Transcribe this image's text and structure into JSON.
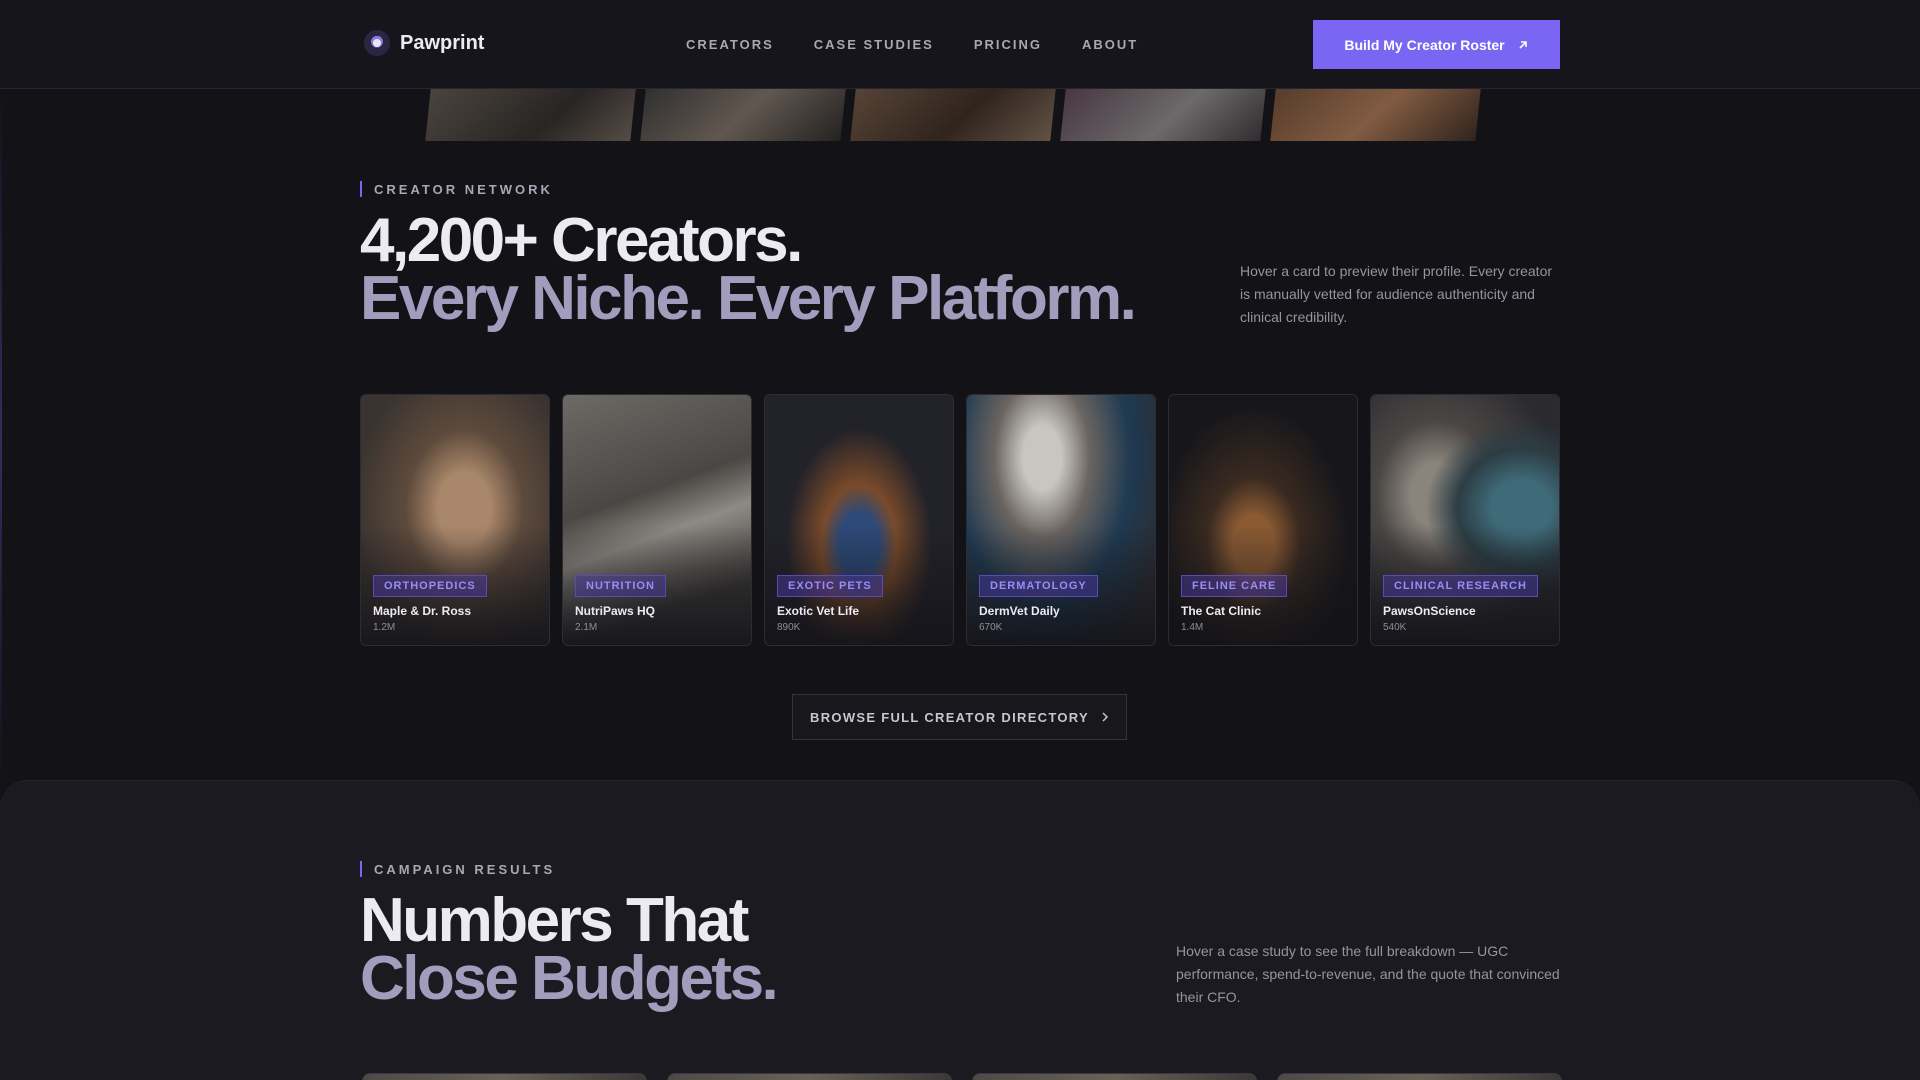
{
  "brand": {
    "name": "Pawprint"
  },
  "nav": {
    "links": [
      "CREATORS",
      "CASE STUDIES",
      "PRICING",
      "ABOUT"
    ],
    "cta_label": "Build My Creator Roster"
  },
  "creator_section": {
    "eyebrow": "CREATOR NETWORK",
    "headline_line1": "4,200+ Creators.",
    "headline_line2": "Every Niche. Every Platform.",
    "description": "Hover a card to preview their profile. Every creator is manually vetted for audience authenticity and clinical credibility.",
    "cards": [
      {
        "tag": "ORTHOPEDICS",
        "name": "Maple & Dr. Ross",
        "count": "1.2M"
      },
      {
        "tag": "NUTRITION",
        "name": "NutriPaws HQ",
        "count": "2.1M"
      },
      {
        "tag": "EXOTIC PETS",
        "name": "Exotic Vet Life",
        "count": "890K"
      },
      {
        "tag": "DERMATOLOGY",
        "name": "DermVet Daily",
        "count": "670K"
      },
      {
        "tag": "FELINE CARE",
        "name": "The Cat Clinic",
        "count": "1.4M"
      },
      {
        "tag": "CLINICAL RESEARCH",
        "name": "PawsOnScience",
        "count": "540K"
      }
    ],
    "browse_label": "BROWSE FULL CREATOR DIRECTORY"
  },
  "results_section": {
    "eyebrow": "CAMPAIGN RESULTS",
    "headline_line1": "Numbers That",
    "headline_line2": "Close Budgets.",
    "description": "Hover a case study to see the full breakdown — UGC performance, spend-to-revenue, and the quote that convinced their CFO."
  },
  "colors": {
    "accent": "#7a66f2",
    "background": "#121217",
    "muted_headline": "#a49cbd"
  }
}
